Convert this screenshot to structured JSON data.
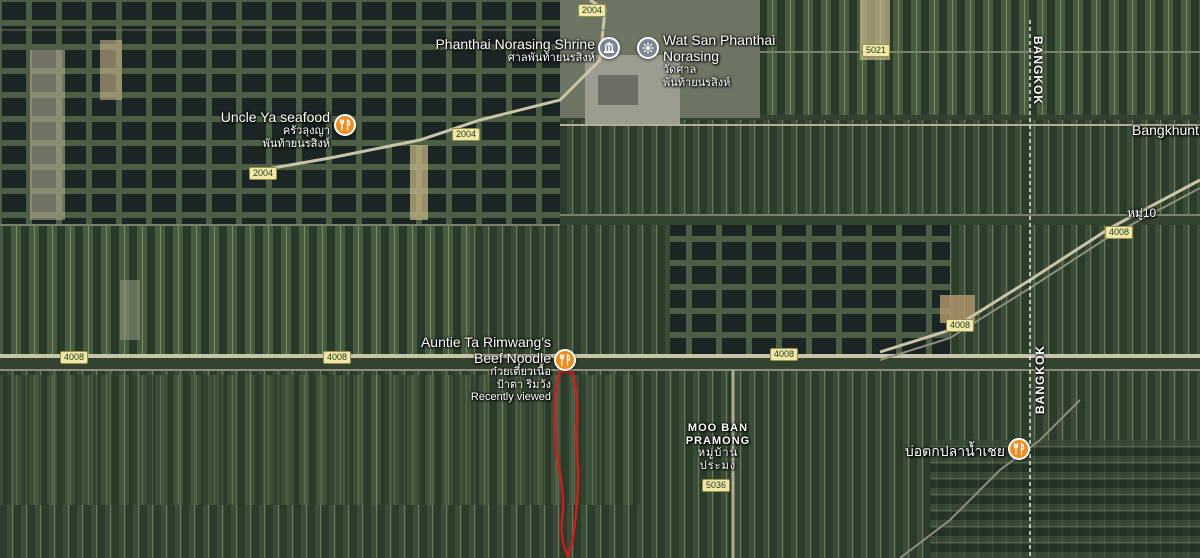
{
  "map": {
    "colors": {
      "route": "#e3141b",
      "food_pin": "#f28c1e",
      "poi_pin": "#7b8694",
      "road": "#c9c3a8",
      "shield_bg": "#f1e7a8"
    },
    "places": {
      "shrine": {
        "name": "Phanthai Norasing Shrine",
        "thai": "ศาลพันท้ายนรสิงห์",
        "icon": "landmark-icon"
      },
      "wat": {
        "name_line1": "Wat San Phanthai",
        "name_line2": "Norasing",
        "thai_line1": "วัดศาล",
        "thai_line2": "พันท้ายนรสิงห์",
        "icon": "temple-icon"
      },
      "uncle_ya": {
        "name": "Uncle Ya seafood",
        "thai_line1": "ครัวลุงญา",
        "thai_line2": "พันท้ายนรสิงห์",
        "icon": "restaurant-icon"
      },
      "auntie_ta": {
        "name_line1": "Auntie Ta Rimwang's",
        "name_line2": "Beef Noodle",
        "thai_line1": "ก๋วยเตี๋ยวเนื้อ",
        "thai_line2": "ป้าตา ริมวัง",
        "status": "Recently viewed",
        "icon": "restaurant-icon"
      },
      "bo_tok": {
        "name": "บ่อตกปลาน้ำเชย",
        "icon": "restaurant-icon"
      }
    },
    "areas": {
      "moo_ban": {
        "line1": "MOO BAN",
        "line2": "PRAMONG",
        "line3": "หมู่บ้าน",
        "line4": "ประมง"
      },
      "bangkhunthian": "Bangkhunth",
      "moo10": "หมู่10",
      "bangkok_top": "BANGKOK",
      "bangkok_mid": "BANGKOK"
    },
    "roads": {
      "r2004_a": "2004",
      "r2004_b": "2004",
      "r2004_c": "2004",
      "r5021": "5021",
      "r4008_a": "4008",
      "r4008_b": "4008",
      "r4008_c": "4008",
      "r4008_d": "4008",
      "r4008_e": "4008",
      "r5036": "5036"
    }
  }
}
